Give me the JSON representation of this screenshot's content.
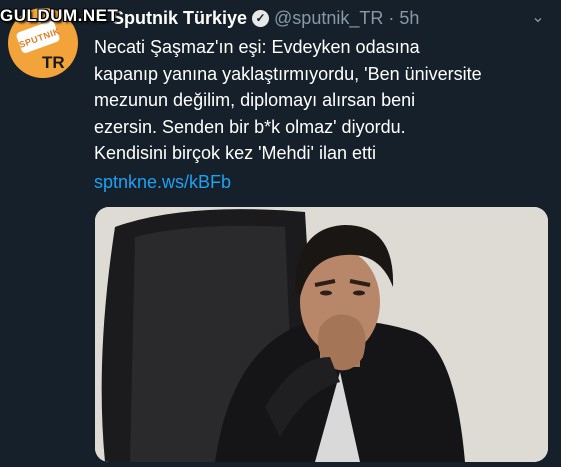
{
  "watermark": "GULDUM.NET",
  "avatar": {
    "word": "SPUTNIK",
    "badge": "TR"
  },
  "tweet": {
    "display_name": "Sputnik Türkiye",
    "handle": "@sputnik_TR",
    "separator": "·",
    "time": "5h",
    "text": "Necati Şaşmaz'ın eşi: Evdeyken odasına\nkapanıp yanına yaklaştırmıyordu, 'Ben üniversite\nmezunun değilim, diplomayı alırsan beni\nezersin. Senden bir b*k olmaz' diyordu.\nKendisini birçok kez 'Mehdi' ilan etti",
    "link": "sptnkne.ws/kBFb"
  },
  "colors": {
    "background": "#15202b",
    "link": "#1da1f2",
    "muted": "#8899a6"
  }
}
